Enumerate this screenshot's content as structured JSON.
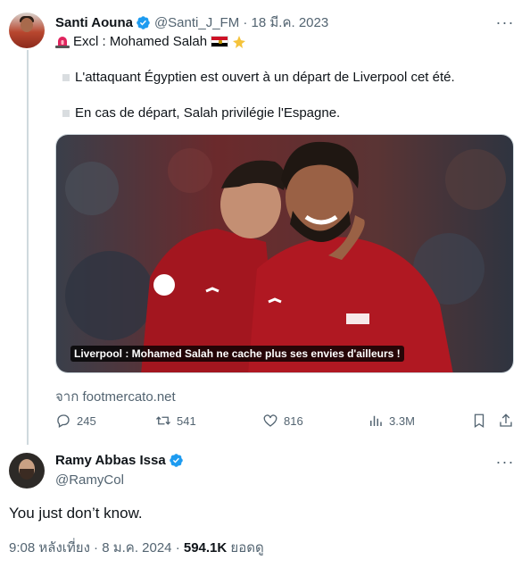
{
  "tweet": {
    "author_name": "Santi Aouna",
    "author_handle": "@Santi_J_FM",
    "date": "18 มี.ค. 2023",
    "handle_date": "@Santi_J_FM · 18 มี.ค. 2023",
    "headline": "Excl : Mohamed Salah",
    "line1": "L'attaquant Égyptien est ouvert à un départ de Liverpool cet été.",
    "line2": "En cas de départ, Salah privilégie l'Espagne.",
    "media_caption": "Liverpool : Mohamed Salah ne cache plus ses envies d'ailleurs !",
    "source": "จาก footmercato.net",
    "stats": {
      "replies": "245",
      "retweets": "541",
      "likes": "816",
      "views": "3.3M"
    }
  },
  "reply": {
    "author_name": "Ramy Abbas Issa",
    "author_handle": "@RamyCol",
    "text": "You just don’t know.",
    "time": "9:08 หลังเที่ยง · 8 ม.ค. 2024 · ",
    "views_count": "594.1K",
    "views_label": " ยอดดู"
  },
  "colors": {
    "verified": "#1d9bf0",
    "secondary_text": "#536471",
    "thread_line": "#cfd9de",
    "jersey_red": "#a3161f"
  },
  "icons": [
    "verified-badge-icon",
    "more-icon",
    "siren-icon",
    "egypt-flag-icon",
    "reply-icon",
    "retweet-icon",
    "like-icon",
    "views-icon",
    "bookmark-icon",
    "share-icon"
  ]
}
